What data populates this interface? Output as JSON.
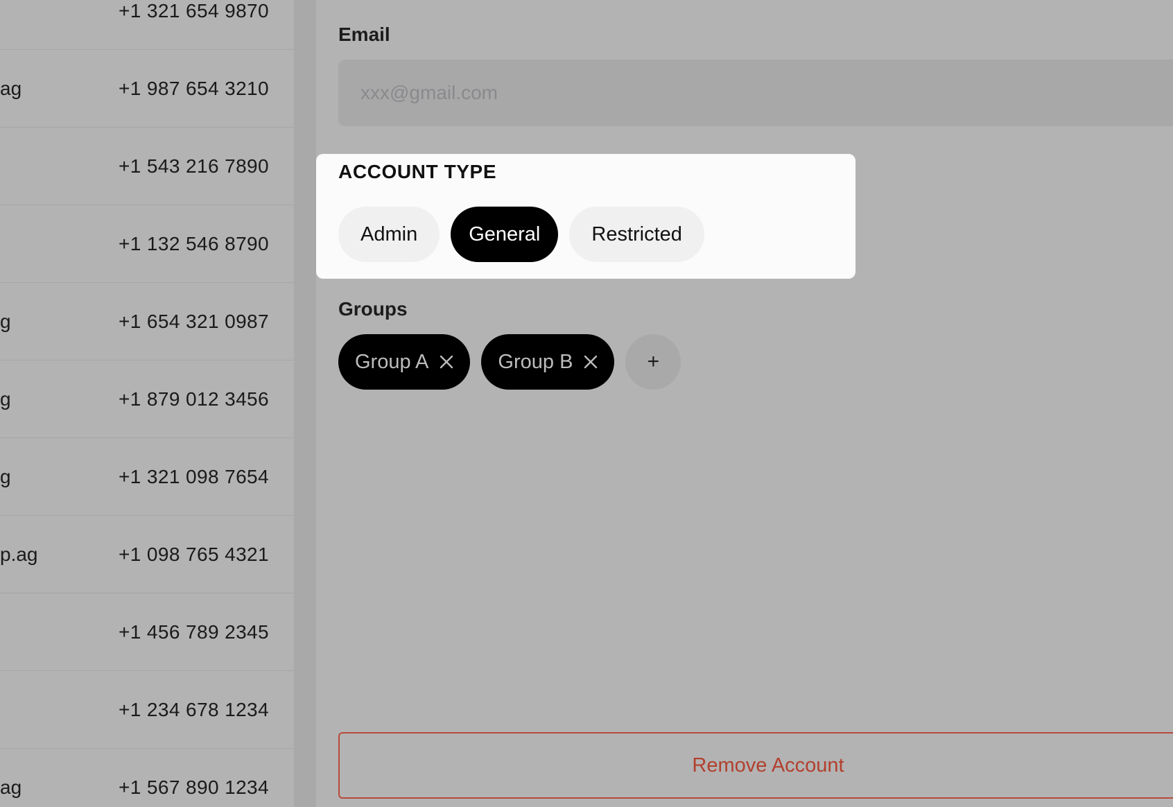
{
  "list": {
    "rows": [
      {
        "email": "",
        "phone": "+1 321 654 9870"
      },
      {
        "email": "ag",
        "phone": "+1 987 654 3210"
      },
      {
        "email": "",
        "phone": "+1 543 216 7890"
      },
      {
        "email": "",
        "phone": "+1 132 546 8790"
      },
      {
        "email": "g",
        "phone": "+1 654 321 0987"
      },
      {
        "email": "g",
        "phone": "+1 879 012 3456"
      },
      {
        "email": "g",
        "phone": "+1 321 098 7654"
      },
      {
        "email": "p.ag",
        "phone": "+1 098 765 4321"
      },
      {
        "email": "",
        "phone": "+1 456 789 2345"
      },
      {
        "email": "",
        "phone": "+1 234 678 1234"
      },
      {
        "email": "ag",
        "phone": "+1 567 890 1234"
      }
    ]
  },
  "form": {
    "email_label": "Email",
    "email_value": "",
    "email_placeholder": "xxx@gmail.com",
    "account_type": {
      "title": "ACCOUNT TYPE",
      "options": [
        "Admin",
        "General",
        "Restricted"
      ],
      "selected": "General"
    },
    "groups_label": "Groups",
    "groups": [
      "Group A",
      "Group B"
    ],
    "add_group_label": "+",
    "remove_label": "Remove Account"
  },
  "colors": {
    "overlay_bg": "#b3b3b3",
    "card_bg": "#fbfbfb",
    "chip_bg": "#000000",
    "danger": "#b2402e"
  },
  "icons": {
    "remove_chip": "close-icon",
    "add_group": "plus-icon"
  }
}
